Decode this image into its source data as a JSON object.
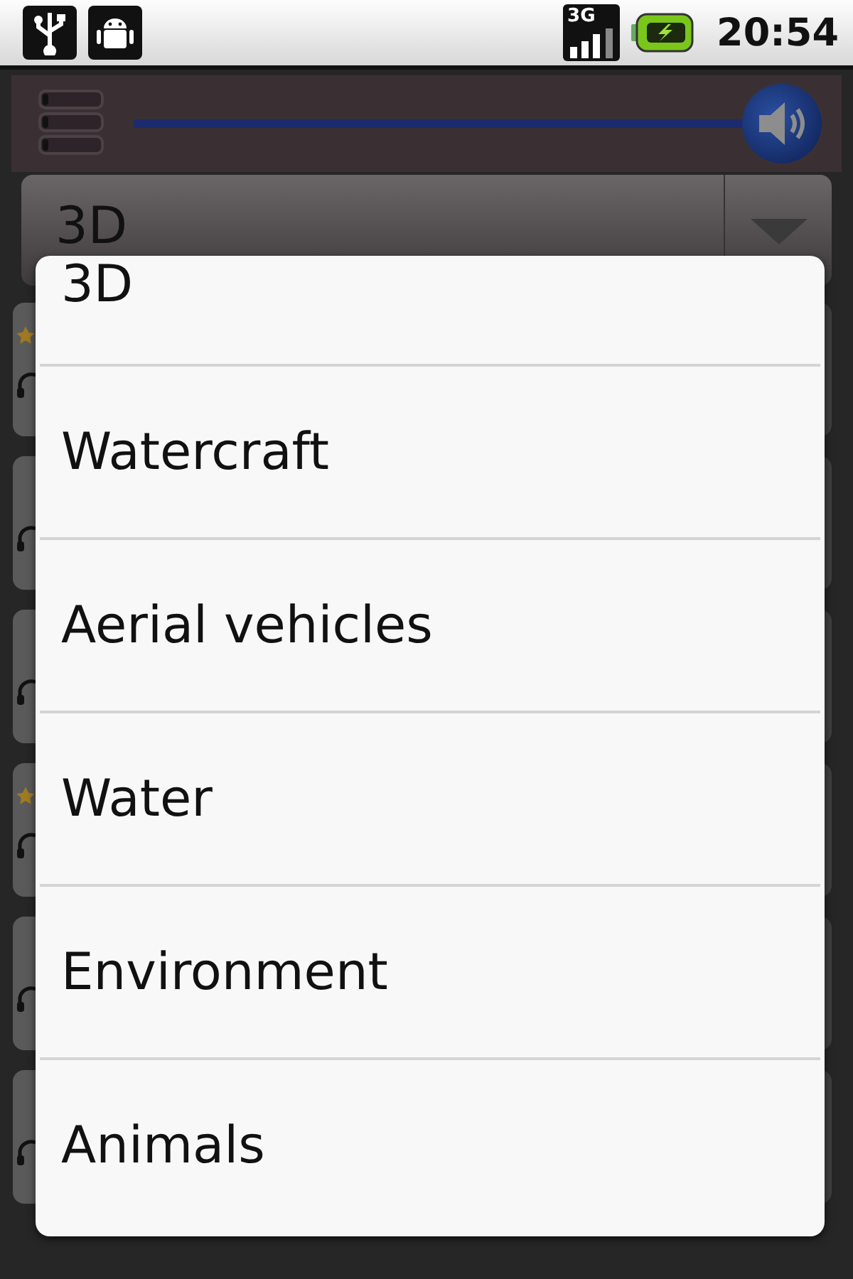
{
  "status_bar": {
    "network": "3G",
    "time": "20:54"
  },
  "volume": {
    "level": 1.0
  },
  "category_spinner": {
    "value": "3D"
  },
  "background_rows": [
    {
      "favorite": true
    },
    {
      "favorite": false
    },
    {
      "favorite": false
    },
    {
      "favorite": true
    },
    {
      "favorite": false
    },
    {
      "favorite": false
    }
  ],
  "dropdown": {
    "items": [
      {
        "label": "3D"
      },
      {
        "label": "Watercraft"
      },
      {
        "label": "Aerial vehicles"
      },
      {
        "label": "Water"
      },
      {
        "label": "Environment"
      },
      {
        "label": "Animals"
      }
    ]
  }
}
